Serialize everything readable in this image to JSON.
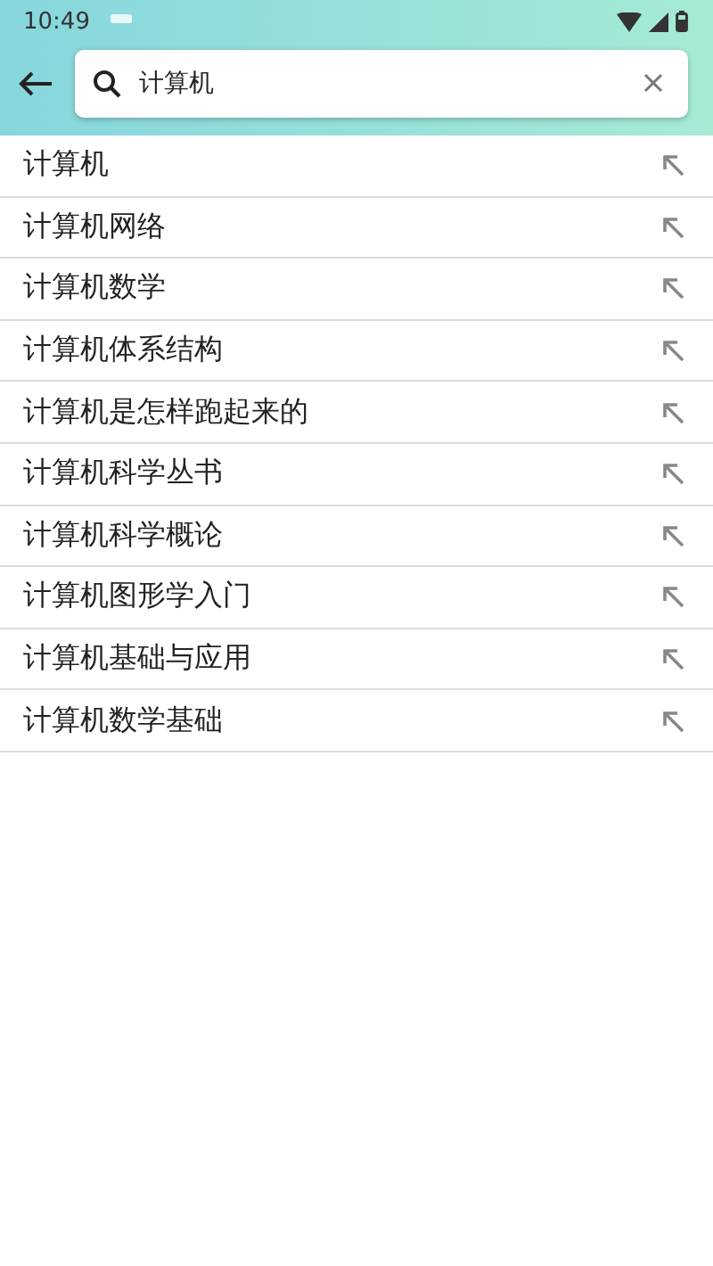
{
  "status_bar": {
    "time": "10:49"
  },
  "search": {
    "value": "计算机"
  },
  "suggestions": [
    {
      "text": "计算机"
    },
    {
      "text": "计算机网络"
    },
    {
      "text": "计算机数学"
    },
    {
      "text": "计算机体系结构"
    },
    {
      "text": "计算机是怎样跑起来的"
    },
    {
      "text": "计算机科学丛书"
    },
    {
      "text": "计算机科学概论"
    },
    {
      "text": "计算机图形学入门"
    },
    {
      "text": "计算机基础与应用"
    },
    {
      "text": "计算机数学基础"
    }
  ]
}
